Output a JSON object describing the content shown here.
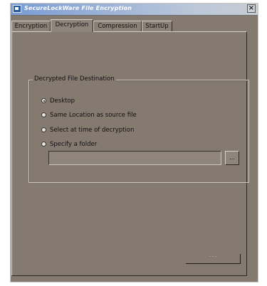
{
  "window": {
    "title": "SecureLockWare File Encryption",
    "close_glyph": "×"
  },
  "tabs": [
    {
      "label": "Encryption",
      "active": false
    },
    {
      "label": "Decryption",
      "active": true
    },
    {
      "label": "Compression",
      "active": false
    },
    {
      "label": "StartUp",
      "active": false
    }
  ],
  "destination": {
    "group_label": "Decrypted File Destination",
    "options": [
      {
        "label": "Desktop",
        "selected": true
      },
      {
        "label": "Same Location as source file",
        "selected": false
      },
      {
        "label": "Select at time of decryption",
        "selected": false
      },
      {
        "label": "Specify a folder",
        "selected": false
      }
    ],
    "folder_value": "",
    "browse_label": "..."
  },
  "bottom_button": {
    "label": "- - -"
  },
  "colors": {
    "window_bg": "#847a70",
    "titlebar_start": "#7a9cd4",
    "titlebar_end": "#c7ccd3"
  },
  "icons": {
    "title": "app-window-icon",
    "close": "close-icon"
  }
}
